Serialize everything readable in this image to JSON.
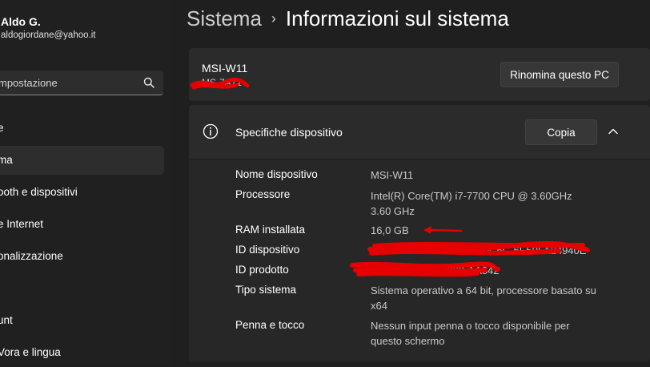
{
  "user": {
    "name": "Aldo G.",
    "email": "aldogiordane@yahoo.it"
  },
  "search": {
    "placeholder": "mpostazione"
  },
  "nav": {
    "items": [
      {
        "label": "e",
        "active": false
      },
      {
        "label": "ma",
        "active": true
      },
      {
        "label": "ooth e dispositivi",
        "active": false
      },
      {
        "label": "e Internet",
        "active": false
      },
      {
        "label": "onalizzazione",
        "active": false
      },
      {
        "label": "",
        "active": false
      },
      {
        "label": "unt",
        "active": false
      },
      {
        "label": "Vora e lingua",
        "active": false
      }
    ]
  },
  "breadcrumb": {
    "parent": "Sistema",
    "separator": "›",
    "current": "Informazioni sul sistema"
  },
  "pc": {
    "name": "MSI-W11",
    "model": "MS-7A71",
    "rename_label": "Rinomina questo PC"
  },
  "specs": {
    "title": "Specifiche dispositivo",
    "copy_label": "Copia",
    "rows": [
      {
        "label": "Nome dispositivo",
        "value": "MSI-W11"
      },
      {
        "label": "Processore",
        "value": "Intel(R) Core(TM) i7-7700 CPU @ 3.60GHz   3.60 GHz"
      },
      {
        "label": "RAM installata",
        "value": "16,0 GB"
      },
      {
        "label": "ID dispositivo",
        "value": "D4E0B9C1-9C7A-42A8-9C6C-6E50FA24940E"
      },
      {
        "label": "ID prodotto",
        "value": "00330-80000-00000-AA842"
      },
      {
        "label": "Tipo sistema",
        "value": "Sistema operativo a 64 bit, processore basato su x64"
      },
      {
        "label": "Penna e tocco",
        "value": "Nessun input penna o tocco disponibile per questo schermo"
      }
    ]
  },
  "colors": {
    "background": "#1f1f1f",
    "card": "#2b2b2b",
    "redaction": "#e60000"
  },
  "icons": {
    "search": "search-icon",
    "info": "info-icon",
    "collapse": "chevron-up-icon",
    "separator": "chevron-right-icon"
  }
}
